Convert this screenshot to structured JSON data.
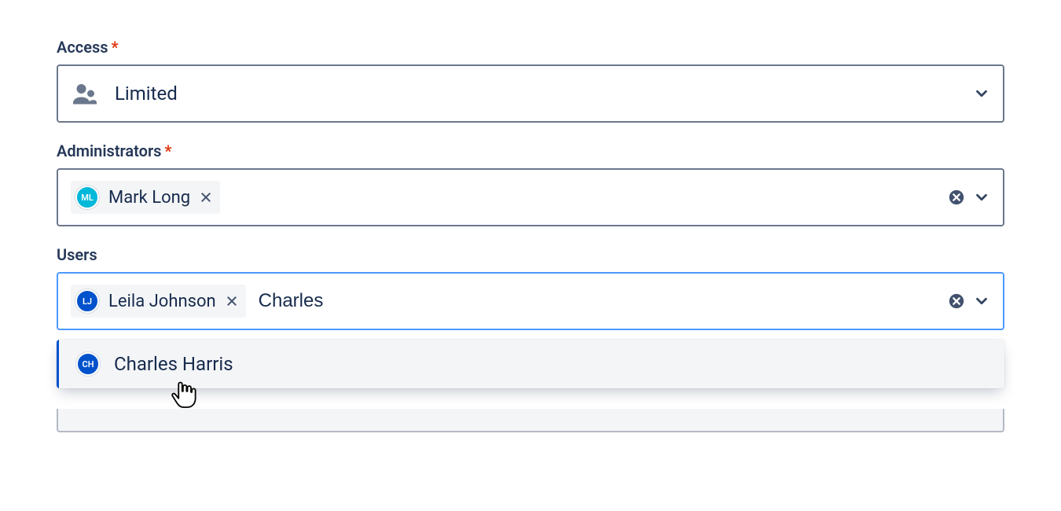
{
  "access": {
    "label": "Access",
    "required_mark": "*",
    "value": "Limited"
  },
  "administrators": {
    "label": "Administrators",
    "required_mark": "*",
    "chips": [
      {
        "initials": "ML",
        "name": "Mark Long",
        "avatar_color": "teal"
      }
    ]
  },
  "users": {
    "label": "Users",
    "chips": [
      {
        "initials": "LJ",
        "name": "Leila Johnson",
        "avatar_color": "blue"
      }
    ],
    "input_value": "Charles",
    "dropdown": [
      {
        "initials": "CH",
        "name": "Charles Harris",
        "avatar_color": "blue"
      }
    ]
  }
}
